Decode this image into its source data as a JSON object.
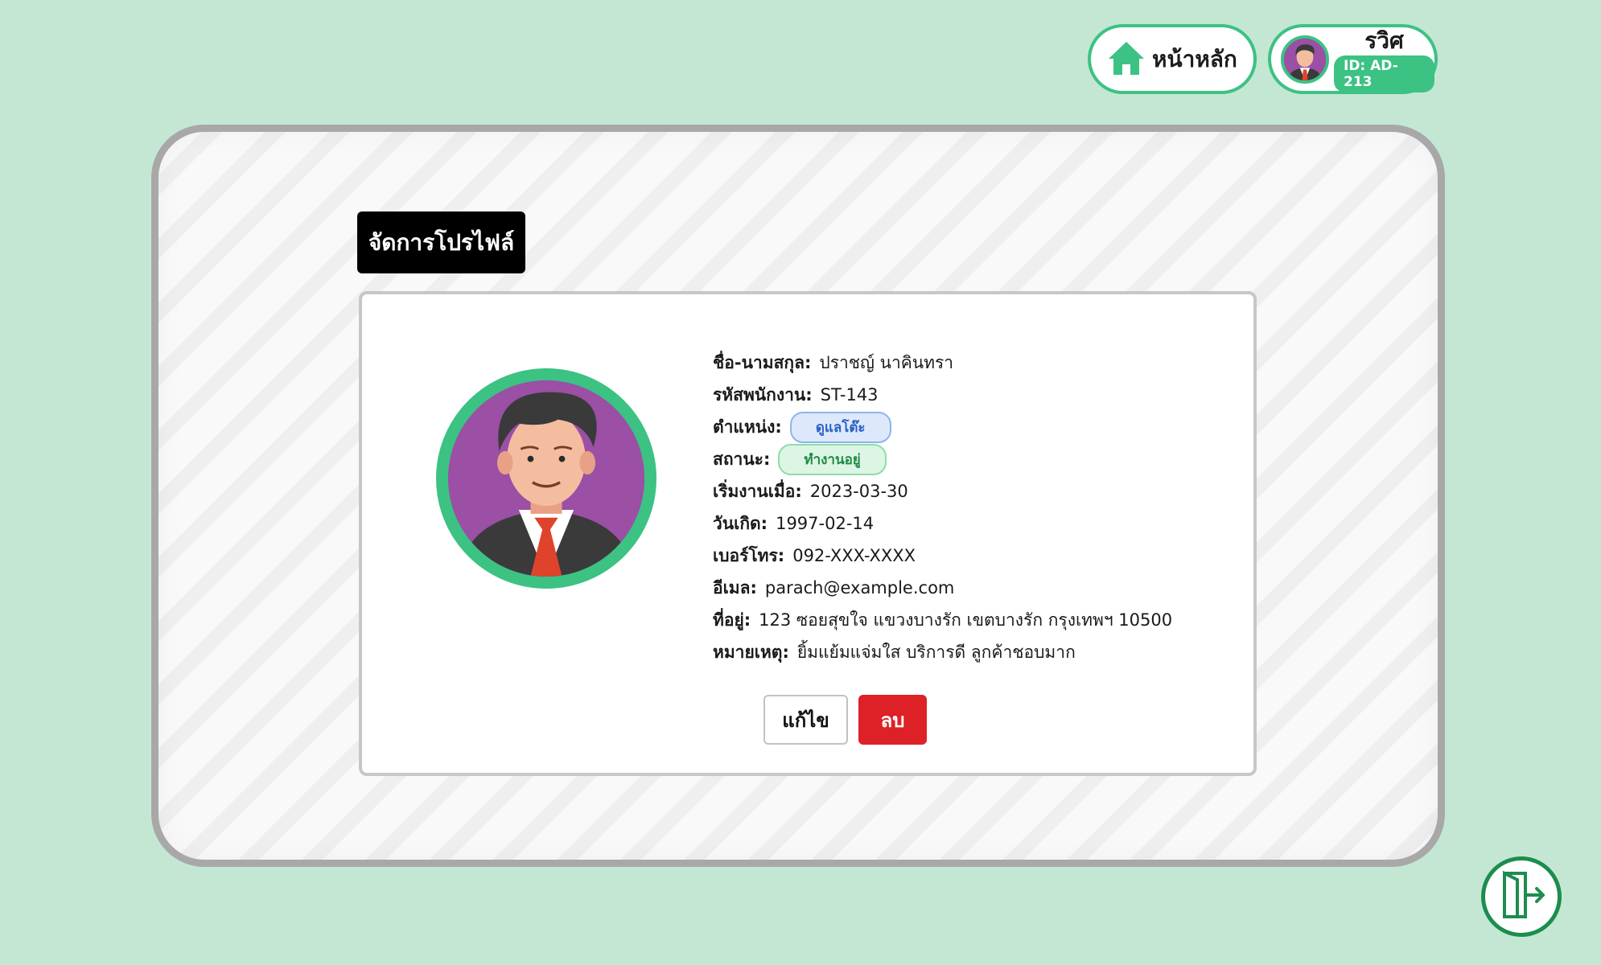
{
  "header": {
    "home_label": "หน้าหลัก",
    "user_name": "รวิศ",
    "user_id": "ID: AD-213"
  },
  "page": {
    "title": "จัดการโปรไฟล์"
  },
  "profile": {
    "name_label": "ชื่อ-นามสกุล:",
    "name_value": "ปราชญ์ นาคินทรา",
    "code_label": "รหัสพนักงาน:",
    "code_value": "ST-143",
    "position_label": "ตำแหน่ง:",
    "position_value": "ดูแลโต๊ะ",
    "status_label": "สถานะ:",
    "status_value": "ทำงานอยู่",
    "start_label": "เริ่มงานเมื่อ:",
    "start_value": "2023-03-30",
    "birth_label": "วันเกิด:",
    "birth_value": "1997-02-14",
    "phone_label": "เบอร์โทร:",
    "phone_value": "092-XXX-XXXX",
    "email_label": "อีเมล:",
    "email_value": "parach@example.com",
    "address_label": "ที่อยู่:",
    "address_value": "123 ซอยสุขใจ แขวงบางรัก เขตบางรัก กรุงเทพฯ 10500",
    "note_label": "หมายเหตุ:",
    "note_value": "ยิ้มแย้มแจ่มใส บริการดี ลูกค้าชอบมาก"
  },
  "actions": {
    "edit_label": "แก้ไข",
    "delete_label": "ลบ"
  },
  "icons": {
    "home": "home-icon",
    "logout": "logout-icon",
    "avatar": "avatar"
  },
  "colors": {
    "accent": "#3cc283",
    "danger": "#de2127",
    "background": "#c4e7d4"
  }
}
